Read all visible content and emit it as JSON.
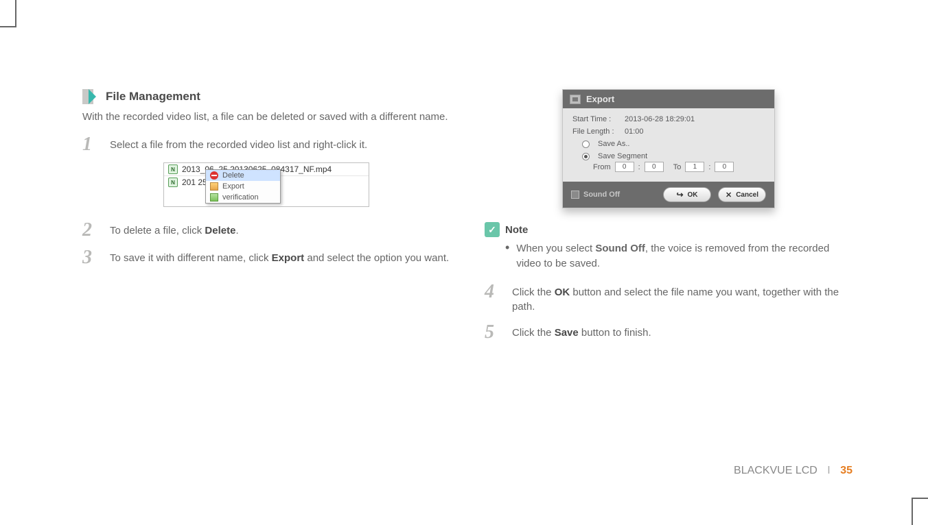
{
  "section": {
    "title": "File Management"
  },
  "intro": "With the recorded video list, a file can be deleted or saved with a different name.",
  "step1": {
    "num": "1",
    "text": "Select a file from the recorded video list and right-click it."
  },
  "ctx": {
    "file1": "2013_06_25    20130625_084317_NF.mp4",
    "file2": "201                           25_084317_NR.mp4",
    "menu": {
      "delete": "Delete",
      "export": "Export",
      "verification": "verification"
    }
  },
  "step2": {
    "num": "2",
    "pre": "To delete a file, click ",
    "b": "Delete",
    "post": "."
  },
  "step3": {
    "num": "3",
    "pre": "To save it with different name, click ",
    "b": "Export",
    "post": " and select the option you want."
  },
  "dlg": {
    "title": "Export",
    "start_label": "Start Time :",
    "start_val": "2013-06-28 18:29:01",
    "len_label": "File Length :",
    "len_val": "01:00",
    "saveas": "Save As..",
    "saveseg": "Save Segment",
    "from": "From",
    "to": "To",
    "f_m": "0",
    "f_s": "0",
    "t_m": "1",
    "t_s": "0",
    "sound_off": "Sound Off",
    "ok": "OK",
    "cancel": "Cancel"
  },
  "note": {
    "title": "Note",
    "pre": "When you select ",
    "b": "Sound Off",
    "post": ", the voice is removed from the recorded video to be saved."
  },
  "step4": {
    "num": "4",
    "pre": "Click the ",
    "b": "OK",
    "post": " button and select the file name you want, together with the path."
  },
  "step5": {
    "num": "5",
    "pre": "Click the ",
    "b": "Save",
    "post": " button to finish."
  },
  "footer": {
    "brand": "BLACKVUE LCD",
    "sep": "I",
    "page": "35"
  }
}
